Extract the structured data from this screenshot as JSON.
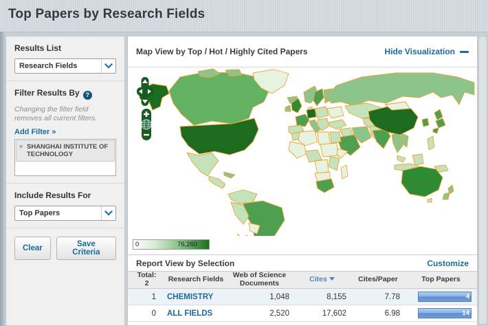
{
  "page": {
    "title": "Top Papers by Research Fields"
  },
  "sidebar": {
    "results_list": {
      "label": "Results List",
      "selected": "Research Fields"
    },
    "filter": {
      "label": "Filter Results By",
      "help_glyph": "?",
      "note": "Changing the filter field removes all current filters.",
      "add_filter": "Add Filter »",
      "chips": [
        {
          "remove_glyph": "×",
          "label": "SHANGHAI INSTITUTE OF TECHNOLOGY"
        }
      ]
    },
    "include": {
      "label": "Include Results For",
      "selected": "Top Papers"
    },
    "buttons": {
      "clear": "Clear",
      "save": "Save Criteria"
    }
  },
  "map_section": {
    "title": "Map View by Top / Hot / Highly Cited Papers",
    "hide_link": "Hide Visualization",
    "controls": {
      "pan": "pan-cross",
      "zoom_in": "+",
      "globe": "globe-reset",
      "zoom_out": "−"
    },
    "legend": {
      "min": "0",
      "max": "76,260"
    }
  },
  "report": {
    "title": "Report View by Selection",
    "customize": "Customize",
    "columns": {
      "total_line1": "Total:",
      "total_line2": "2",
      "field": "Research Fields",
      "docs_line1": "Web of Science",
      "docs_line2": "Documents",
      "cites": "Cites",
      "cites_per_paper": "Cites/Paper",
      "top_papers": "Top Papers"
    },
    "rows": [
      {
        "rank": "1",
        "field": "CHEMISTRY",
        "docs": "1,048",
        "cites": "8,155",
        "cites_per_paper": "7.78",
        "top_papers": "4"
      },
      {
        "rank": "0",
        "field": "ALL FIELDS",
        "docs": "2,520",
        "cites": "17,602",
        "cites_per_paper": "6.98",
        "top_papers": "14"
      }
    ]
  },
  "colors": {
    "header_band": "#cdd6dc",
    "page_bg": "#c9d0d5",
    "link": "#1b6a9c",
    "map_border": "#efa230",
    "map_g1": "#e7f3e1",
    "map_g2": "#c4e2bc",
    "map_g3": "#8cc48c",
    "map_g4": "#4f9f50",
    "map_g35": "#2f8a34",
    "map_g5": "#1c6b1e",
    "map_canada": "#63b263",
    "legend_end": "#1d6e1d",
    "control_green": "#175c20",
    "bar_top": "#aecdf0",
    "bar_bottom": "#6f9cd8",
    "row_alt": "#edf2f8"
  }
}
